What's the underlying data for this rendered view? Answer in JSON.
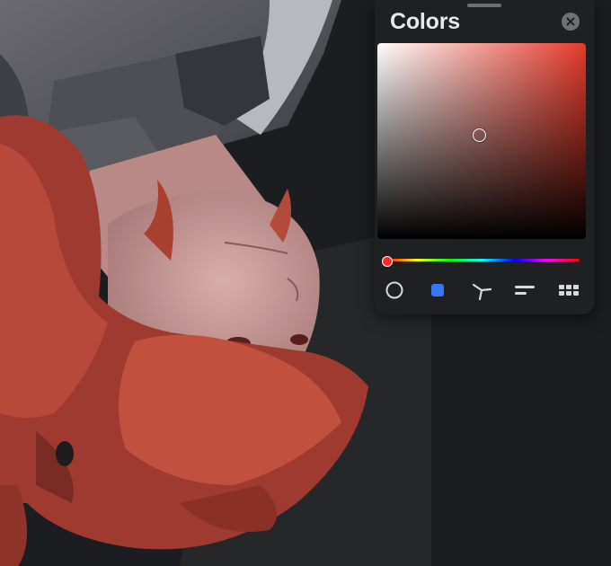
{
  "panel": {
    "title": "Colors",
    "close_icon": "close-x-icon"
  },
  "picker": {
    "hue_color": "#e63a2a",
    "accent": "#3478f6",
    "mode_tabs": [
      {
        "id": "disc",
        "icon": "color-disc-icon",
        "active": false
      },
      {
        "id": "classic",
        "icon": "classic-square-icon",
        "active": true
      },
      {
        "id": "harmony",
        "icon": "harmony-icon",
        "active": false
      },
      {
        "id": "value",
        "icon": "sliders-icon",
        "active": false
      },
      {
        "id": "palettes",
        "icon": "palette-grid-icon",
        "active": false
      }
    ]
  }
}
